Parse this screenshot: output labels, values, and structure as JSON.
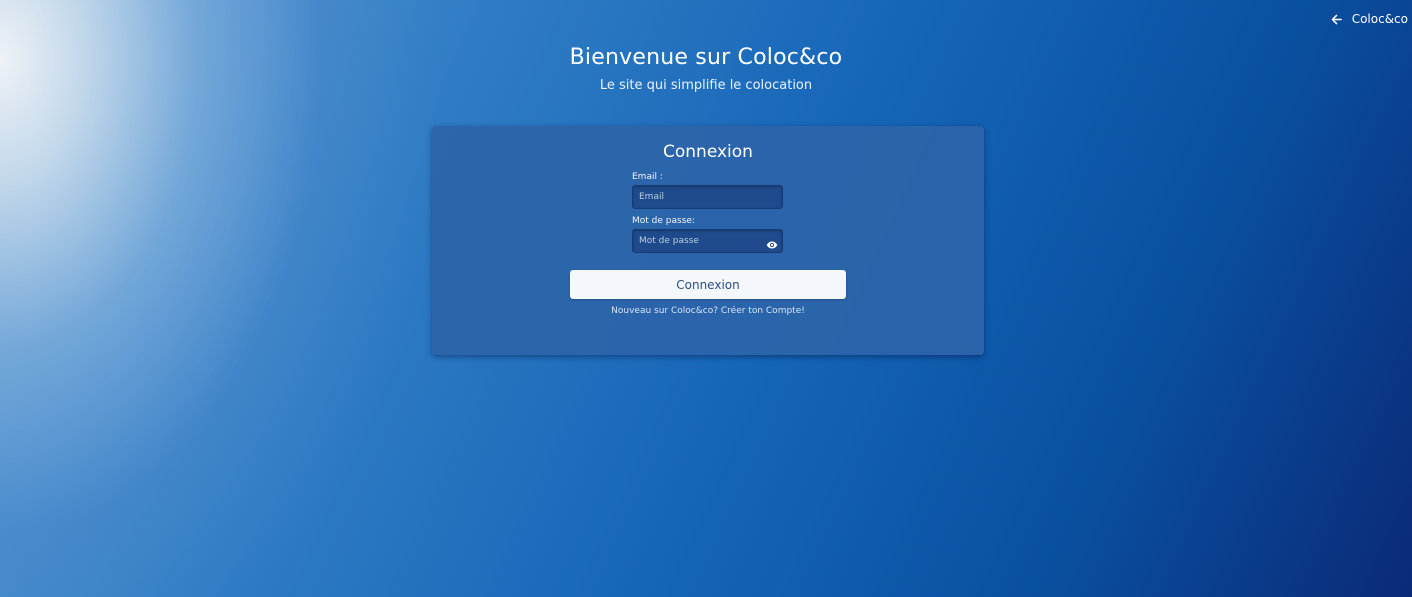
{
  "nav": {
    "back_label": "Coloc&co",
    "back_icon": "arrow-left-icon"
  },
  "hero": {
    "title": "Bienvenue sur Coloc&co",
    "subtitle": "Le site qui simplifie le colocation"
  },
  "login": {
    "title": "Connexion",
    "email_label": "Email :",
    "email_placeholder": "Email",
    "email_value": "",
    "password_label": "Mot de passe:",
    "password_placeholder": "Mot de passe",
    "password_value": "",
    "show_password_icon": "eye-icon",
    "submit_label": "Connexion",
    "signup_prompt": "Nouveau sur Coloc&co?",
    "signup_link": "Créer ton Compte!"
  },
  "colors": {
    "card_background": "#2c64a8",
    "button_background": "#f4f7fb",
    "button_text": "#2a4f84",
    "input_background": "#1f4b8c"
  }
}
